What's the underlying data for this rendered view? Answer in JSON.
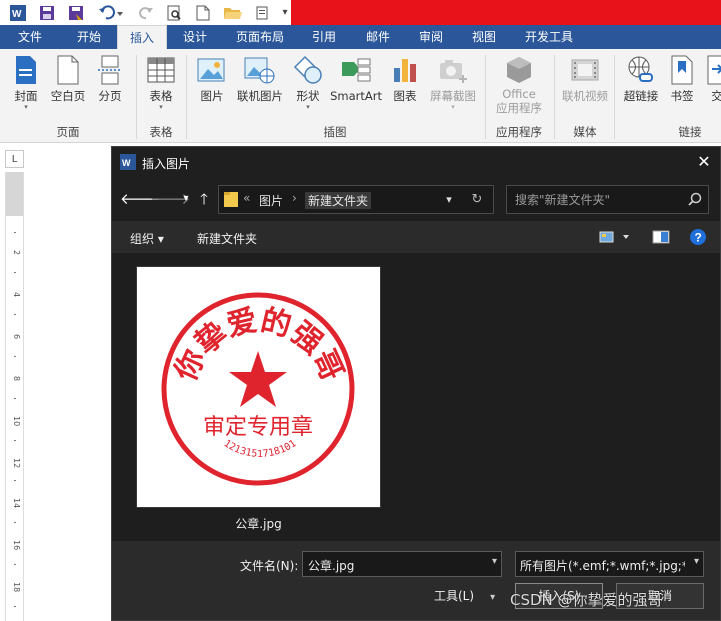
{
  "ribbon_tabs": [
    {
      "label": "文件"
    },
    {
      "label": "开始"
    },
    {
      "label": "插入"
    },
    {
      "label": "设计"
    },
    {
      "label": "页面布局"
    },
    {
      "label": "引用"
    },
    {
      "label": "邮件"
    },
    {
      "label": "审阅"
    },
    {
      "label": "视图"
    },
    {
      "label": "开发工具"
    }
  ],
  "active_tab": "插入",
  "ribbon": {
    "buttons": {
      "cover": "封面",
      "blank_page": "空白页",
      "page_break": "分页",
      "table": "表格",
      "picture": "图片",
      "online_picture": "联机图片",
      "shapes": "形状",
      "smartart": "SmartArt",
      "chart": "图表",
      "screenshot": "屏幕截图",
      "office_apps_line1": "Office",
      "office_apps_line2": "应用程序",
      "online_video": "联机视频",
      "hyperlink": "超链接",
      "bookmark": "书签",
      "cross_ref": "交"
    },
    "groups": {
      "pages": "页面",
      "tables": "表格",
      "illustrations": "插图",
      "apps": "应用程序",
      "media": "媒体",
      "links": "链接"
    }
  },
  "ruler": {
    "corner": "L",
    "numbers": [
      "2",
      "4",
      "6",
      "8",
      "10",
      "12",
      "14",
      "16",
      "18"
    ]
  },
  "dialog": {
    "title": "插入图片",
    "close_glyph": "✕",
    "address": {
      "prefix": "«",
      "crumbs": [
        "图片",
        "新建文件夹"
      ]
    },
    "search_placeholder": "搜索\"新建文件夹\"",
    "toolbar": {
      "organize": "组织 ▾",
      "new_folder": "新建文件夹"
    },
    "files": [
      {
        "name": "公章.jpg",
        "stamp_text_top": "你挚爱的强哥",
        "stamp_text_bottom": "审定专用章",
        "stamp_number": "1213151718101"
      }
    ],
    "filename_label": "文件名(N):",
    "filename_value": "公章.jpg",
    "filetype_value": "所有图片(*.emf;*.wmf;*.jpg;*.jp",
    "tools_label": "工具(L)",
    "insert_label": "插入(S)",
    "cancel_label": "取消"
  },
  "watermark": "CSDN @你挚爱的强哥",
  "colors": {
    "brand_blue": "#2b579a",
    "title_red": "#e8121b",
    "stamp_red": "#e0242e"
  }
}
